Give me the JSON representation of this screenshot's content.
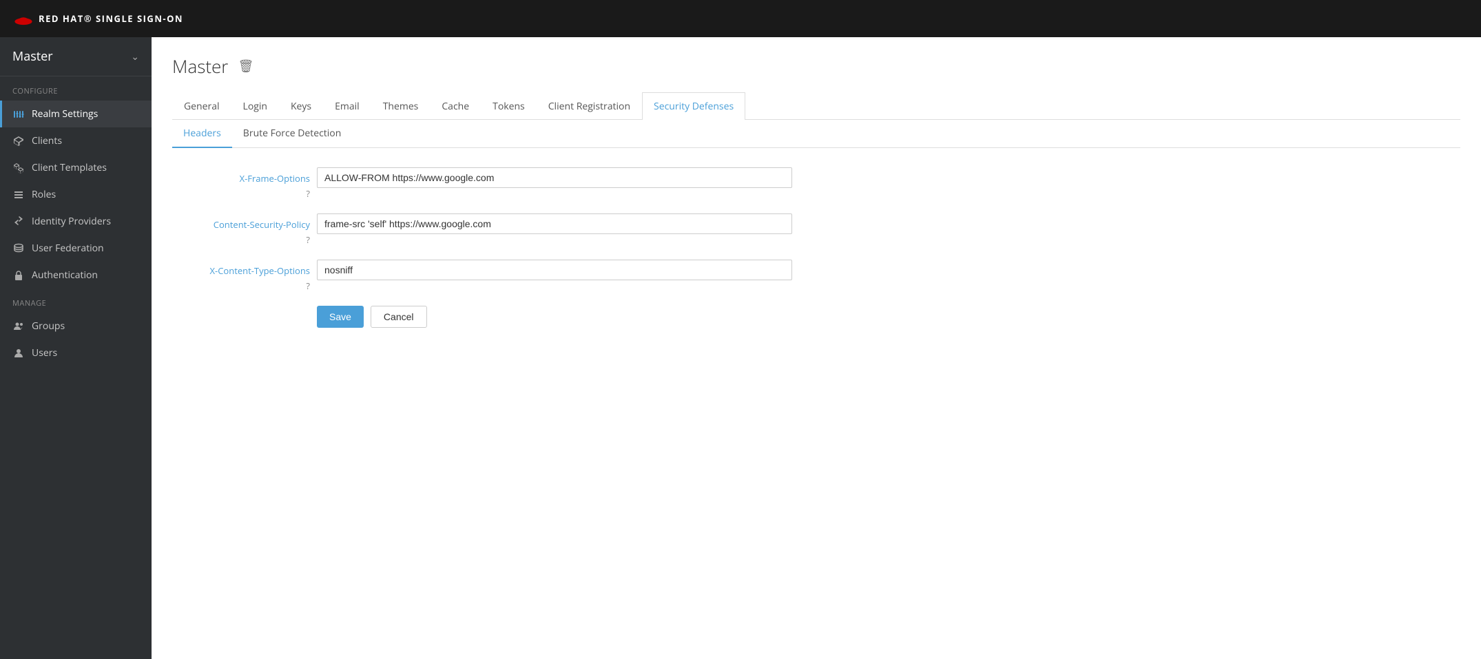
{
  "topbar": {
    "title": "RED HAT® SINGLE SIGN-ON"
  },
  "sidebar": {
    "realm_name": "Master",
    "sections": [
      {
        "label": "Configure",
        "items": [
          {
            "id": "realm-settings",
            "label": "Realm Settings",
            "icon": "sliders-icon",
            "active": true
          },
          {
            "id": "clients",
            "label": "Clients",
            "icon": "cube-icon",
            "active": false
          },
          {
            "id": "client-templates",
            "label": "Client Templates",
            "icon": "cubes-icon",
            "active": false
          },
          {
            "id": "roles",
            "label": "Roles",
            "icon": "list-icon",
            "active": false
          },
          {
            "id": "identity-providers",
            "label": "Identity Providers",
            "icon": "exchange-icon",
            "active": false
          },
          {
            "id": "user-federation",
            "label": "User Federation",
            "icon": "database-icon",
            "active": false
          },
          {
            "id": "authentication",
            "label": "Authentication",
            "icon": "lock-icon",
            "active": false
          }
        ]
      },
      {
        "label": "Manage",
        "items": [
          {
            "id": "groups",
            "label": "Groups",
            "icon": "users-icon",
            "active": false
          },
          {
            "id": "users",
            "label": "Users",
            "icon": "user-icon",
            "active": false
          }
        ]
      }
    ]
  },
  "page": {
    "title": "Master",
    "trash_label": "🗑"
  },
  "tabs_primary": [
    {
      "id": "general",
      "label": "General",
      "active": false
    },
    {
      "id": "login",
      "label": "Login",
      "active": false
    },
    {
      "id": "keys",
      "label": "Keys",
      "active": false
    },
    {
      "id": "email",
      "label": "Email",
      "active": false
    },
    {
      "id": "themes",
      "label": "Themes",
      "active": false
    },
    {
      "id": "cache",
      "label": "Cache",
      "active": false
    },
    {
      "id": "tokens",
      "label": "Tokens",
      "active": false
    },
    {
      "id": "client-registration",
      "label": "Client Registration",
      "active": false
    },
    {
      "id": "security-defenses",
      "label": "Security Defenses",
      "active": true
    }
  ],
  "tabs_secondary": [
    {
      "id": "headers",
      "label": "Headers",
      "active": true
    },
    {
      "id": "brute-force",
      "label": "Brute Force Detection",
      "active": false
    }
  ],
  "form": {
    "fields": [
      {
        "id": "x-frame-options",
        "label": "X-Frame-Options",
        "has_help": true,
        "value": "ALLOW-FROM https://www.google.com",
        "placeholder": ""
      },
      {
        "id": "content-security-policy",
        "label": "Content-Security-Policy",
        "has_help": true,
        "value": "frame-src 'self' https://www.google.com",
        "placeholder": ""
      },
      {
        "id": "x-content-type-options",
        "label": "X-Content-Type-Options",
        "has_help": true,
        "value": "nosniff",
        "placeholder": ""
      }
    ],
    "save_label": "Save",
    "cancel_label": "Cancel"
  }
}
